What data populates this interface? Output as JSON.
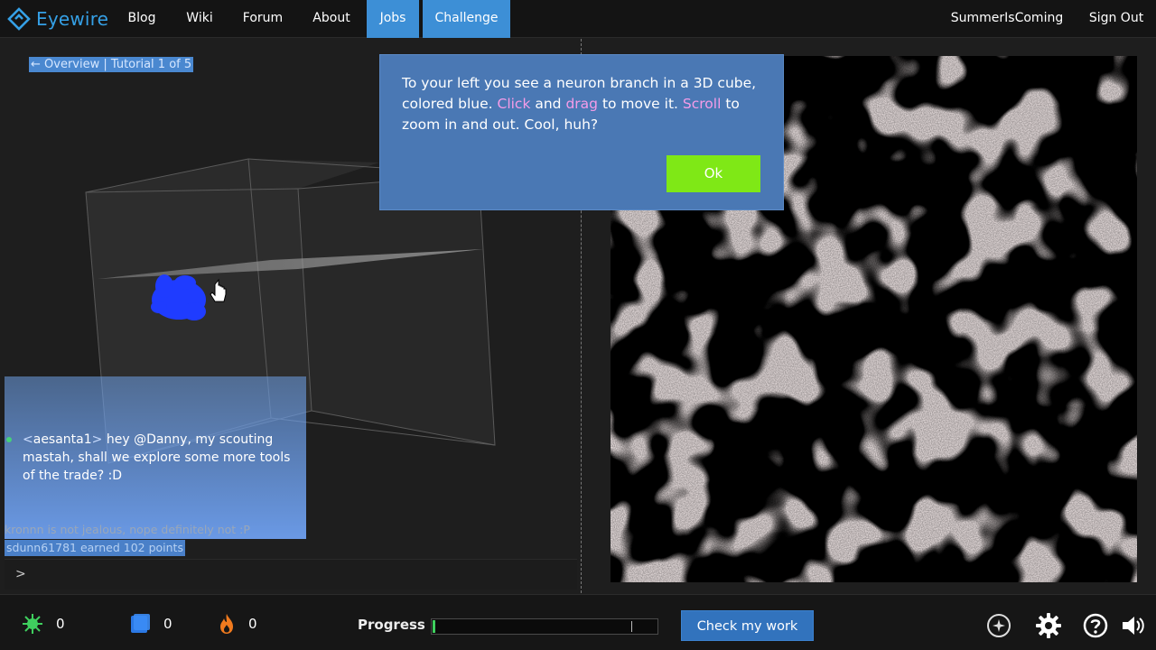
{
  "nav": {
    "logo_text": "Eyewire",
    "items": [
      {
        "label": "Blog"
      },
      {
        "label": "Wiki"
      },
      {
        "label": "Forum"
      },
      {
        "label": "About"
      },
      {
        "label": "Jobs",
        "active": true
      },
      {
        "label": "Challenge",
        "active": true
      }
    ],
    "user": "SummerIsComing",
    "signout": "Sign Out"
  },
  "breadcrumb": "← Overview | Tutorial 1 of 5",
  "tooltip": {
    "parts": [
      "To your left you see a neuron branch in a 3D cube, colored blue. ",
      "Click",
      " and ",
      "drag",
      " to move it. ",
      "Scroll",
      " to zoom in and out. Cool, huh?"
    ],
    "ok_label": "Ok"
  },
  "chat": {
    "username": "aesanta1",
    "message": "hey @Danny, my scouting mastah, shall we explore some more tools of the trade? :D",
    "line1": "kronnn is not jealous, nope definitely not :P",
    "line2": "sdunn61781 earned 102 points",
    "prompt": ">"
  },
  "stats": {
    "trace": "0",
    "cubes": "0",
    "streak": "0"
  },
  "progress": {
    "label": "Progress",
    "value": 0.01
  },
  "check_button": "Check my work",
  "colors": {
    "accent_blue": "#3d8fd6",
    "ok_green": "#7fe816",
    "highlight_pink": "#f59ce8",
    "neuron_blue": "#1a3cff"
  },
  "icons": [
    "eye-logo-icon",
    "trace-icon",
    "cube-icon",
    "flame-icon",
    "compass-icon",
    "gear-icon",
    "help-icon",
    "sound-icon"
  ]
}
